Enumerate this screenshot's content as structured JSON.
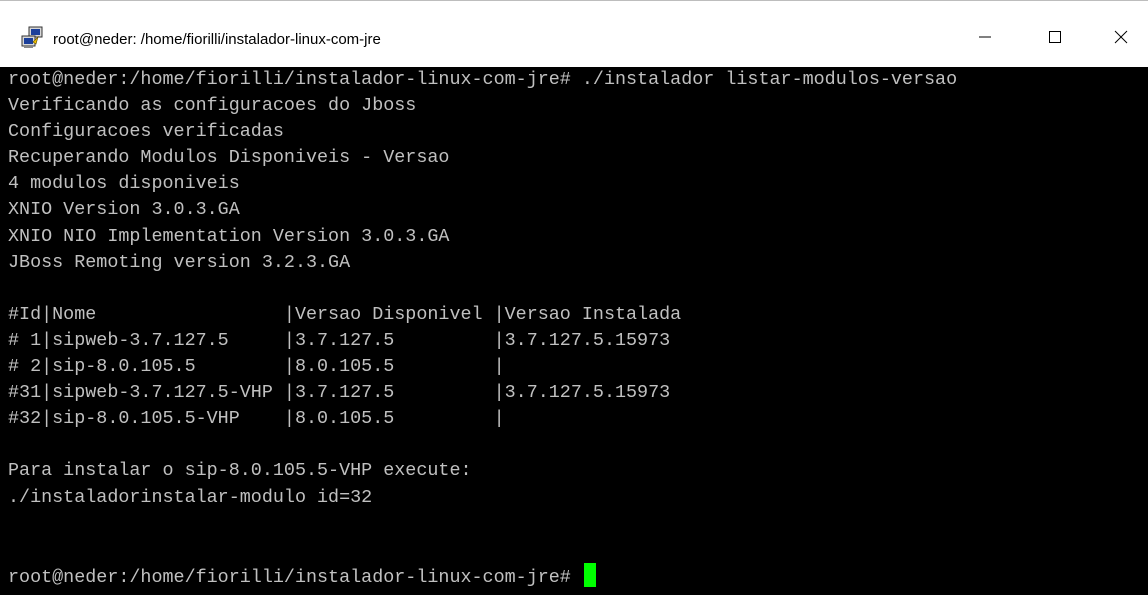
{
  "window": {
    "title": "root@neder: /home/fiorilli/instalador-linux-com-jre",
    "app_icon": "putty-icon",
    "controls": {
      "minimize": "minimize-icon",
      "maximize": "maximize-icon",
      "close": "close-icon"
    }
  },
  "terminal": {
    "text_color": "#c0c0c0",
    "background": "#000000",
    "cursor_color": "#00ff00",
    "lines": [
      "root@neder:/home/fiorilli/instalador-linux-com-jre# ./instalador listar-modulos-versao",
      "Verificando as configuracoes do Jboss",
      "Configuracoes verificadas",
      "Recuperando Modulos Disponiveis - Versao",
      "4 modulos disponiveis",
      "XNIO Version 3.0.3.GA",
      "XNIO NIO Implementation Version 3.0.3.GA",
      "JBoss Remoting version 3.2.3.GA",
      "",
      "#Id|Nome                 |Versao Disponivel |Versao Instalada",
      "# 1|sipweb-3.7.127.5     |3.7.127.5         |3.7.127.5.15973",
      "# 2|sip-8.0.105.5        |8.0.105.5         |",
      "#31|sipweb-3.7.127.5-VHP |3.7.127.5         |3.7.127.5.15973",
      "#32|sip-8.0.105.5-VHP    |8.0.105.5         |",
      "",
      "Para instalar o sip-8.0.105.5-VHP execute:",
      "./instaladorinstalar-modulo id=32",
      "",
      "",
      "root@neder:/home/fiorilli/instalador-linux-com-jre# "
    ]
  }
}
